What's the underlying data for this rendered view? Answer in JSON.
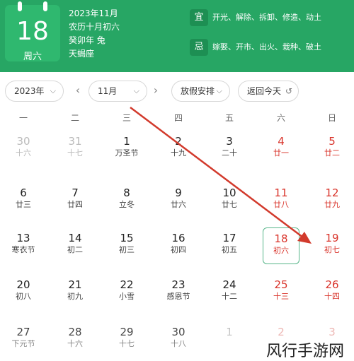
{
  "header": {
    "day": "18",
    "weekday": "周六",
    "date": "2023年11月",
    "lunar": "农历十月初六",
    "ganzhi": "癸卯年 兔",
    "zodiac": "天蝎座",
    "yi_label": "宜",
    "yi_text": "开光、解除、拆卸、修造、动土",
    "ji_label": "忌",
    "ji_text": "嫁娶、开市、出火、栽种、破土"
  },
  "toolbar": {
    "year": "2023年",
    "month": "11月",
    "holiday": "放假安排",
    "back_today": "返回今天",
    "back_icon": "↺",
    "caret": "⌵"
  },
  "weekdays": [
    "一",
    "二",
    "三",
    "四",
    "五",
    "六",
    "日"
  ],
  "weeks": [
    [
      {
        "n": "30",
        "l": "十六",
        "t": "dim"
      },
      {
        "n": "31",
        "l": "十七",
        "t": "dim"
      },
      {
        "n": "1",
        "l": "万圣节",
        "t": ""
      },
      {
        "n": "2",
        "l": "十九",
        "t": ""
      },
      {
        "n": "3",
        "l": "二十",
        "t": ""
      },
      {
        "n": "4",
        "l": "廿一",
        "t": "red"
      },
      {
        "n": "5",
        "l": "廿二",
        "t": "red"
      }
    ],
    [
      {
        "n": "6",
        "l": "廿三",
        "t": ""
      },
      {
        "n": "7",
        "l": "廿四",
        "t": ""
      },
      {
        "n": "8",
        "l": "立冬",
        "t": ""
      },
      {
        "n": "9",
        "l": "廿六",
        "t": ""
      },
      {
        "n": "10",
        "l": "廿七",
        "t": ""
      },
      {
        "n": "11",
        "l": "廿八",
        "t": "red"
      },
      {
        "n": "12",
        "l": "廿九",
        "t": "red"
      }
    ],
    [
      {
        "n": "13",
        "l": "寒衣节",
        "t": ""
      },
      {
        "n": "14",
        "l": "初二",
        "t": ""
      },
      {
        "n": "15",
        "l": "初三",
        "t": ""
      },
      {
        "n": "16",
        "l": "初四",
        "t": ""
      },
      {
        "n": "17",
        "l": "初五",
        "t": ""
      },
      {
        "n": "18",
        "l": "初六",
        "t": "red today"
      },
      {
        "n": "19",
        "l": "初七",
        "t": "red"
      }
    ],
    [
      {
        "n": "20",
        "l": "初八",
        "t": ""
      },
      {
        "n": "21",
        "l": "初九",
        "t": ""
      },
      {
        "n": "22",
        "l": "小雪",
        "t": ""
      },
      {
        "n": "23",
        "l": "感恩节",
        "t": ""
      },
      {
        "n": "24",
        "l": "十二",
        "t": ""
      },
      {
        "n": "25",
        "l": "十三",
        "t": "red"
      },
      {
        "n": "26",
        "l": "十四",
        "t": "red"
      }
    ],
    [
      {
        "n": "27",
        "l": "下元节",
        "t": ""
      },
      {
        "n": "28",
        "l": "十六",
        "t": ""
      },
      {
        "n": "29",
        "l": "十七",
        "t": ""
      },
      {
        "n": "30",
        "l": "十八",
        "t": ""
      },
      {
        "n": "1",
        "l": "",
        "t": "dim"
      },
      {
        "n": "2",
        "l": "",
        "t": "dimred"
      },
      {
        "n": "3",
        "l": "",
        "t": "dimred"
      }
    ]
  ],
  "watermark": "风行手游网",
  "colors": {
    "header": "#27a664",
    "weekend": "#d9342b",
    "today_border": "#57b589",
    "annotation_arrow": "#d23a2c"
  }
}
